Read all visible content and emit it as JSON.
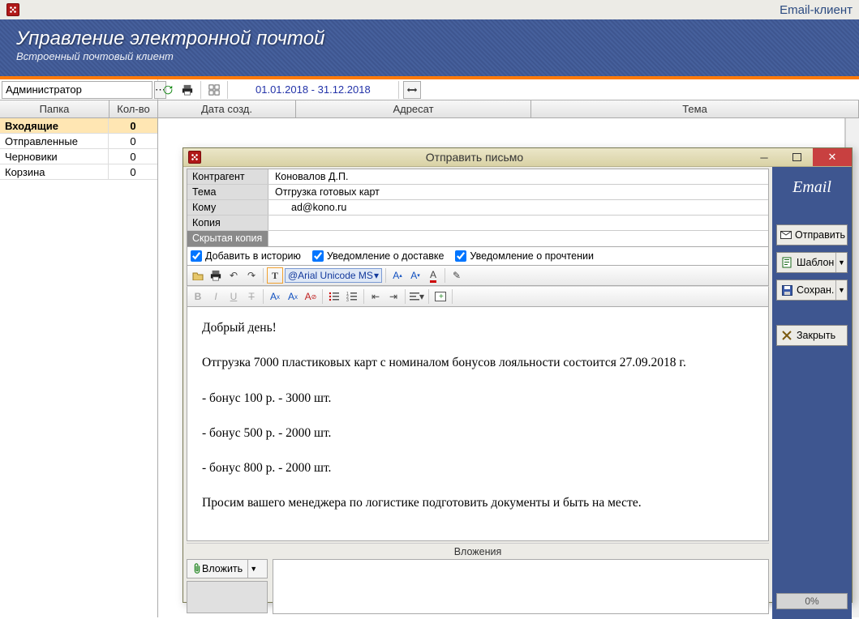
{
  "app": {
    "title": "Email-клиент",
    "user": "Администратор"
  },
  "banner": {
    "heading": "Управление электронной почтой",
    "sub": "Встроенный почтовый клиент"
  },
  "toolbar": {
    "date_range": "01.01.2018 - 31.12.2018"
  },
  "folder_headers": {
    "name": "Папка",
    "count": "Кол-во"
  },
  "folders": [
    {
      "name": "Входящие",
      "count": "0",
      "selected": true
    },
    {
      "name": "Отправленные",
      "count": "0"
    },
    {
      "name": "Черновики",
      "count": "0"
    },
    {
      "name": "Корзина",
      "count": "0"
    }
  ],
  "columns": {
    "date": "Дата созд.",
    "recipient": "Адресат",
    "subject": "Тема"
  },
  "compose": {
    "window_title": "Отправить письмо",
    "fields": {
      "contragent_label": "Контрагент",
      "contragent": "Коновалов Д.П.",
      "subject_label": "Тема",
      "subject": "Отгрузка готовых карт",
      "to_label": "Кому",
      "to": "ad@kono.ru",
      "cc_label": "Копия",
      "cc": "",
      "bcc_label": "Скрытая копия",
      "bcc": ""
    },
    "checks": {
      "history": "Добавить в историю",
      "delivery": "Уведомление о доставке",
      "read": "Уведомление о прочтении"
    },
    "font": "@Arial Unicode MS",
    "body": {
      "p1": "Добрый день!",
      "p2": "Отгрузка 7000 пластиковых карт с номиналом бонусов лояльности состоится 27.09.2018 г.",
      "p3": "- бонус 100 р. - 3000 шт.",
      "p4": "- бонус 500 р. - 2000 шт.",
      "p5": "- бонус 800 р. - 2000 шт.",
      "p6": "Просим вашего менеджера по логистике подготовить документы и быть на месте."
    },
    "attach": {
      "header": "Вложения",
      "button": "Вложить"
    },
    "side": {
      "brand": "Email",
      "send": "Отправить",
      "template": "Шаблон",
      "save": "Сохран.",
      "close": "Закрыть",
      "progress": "0%"
    }
  }
}
